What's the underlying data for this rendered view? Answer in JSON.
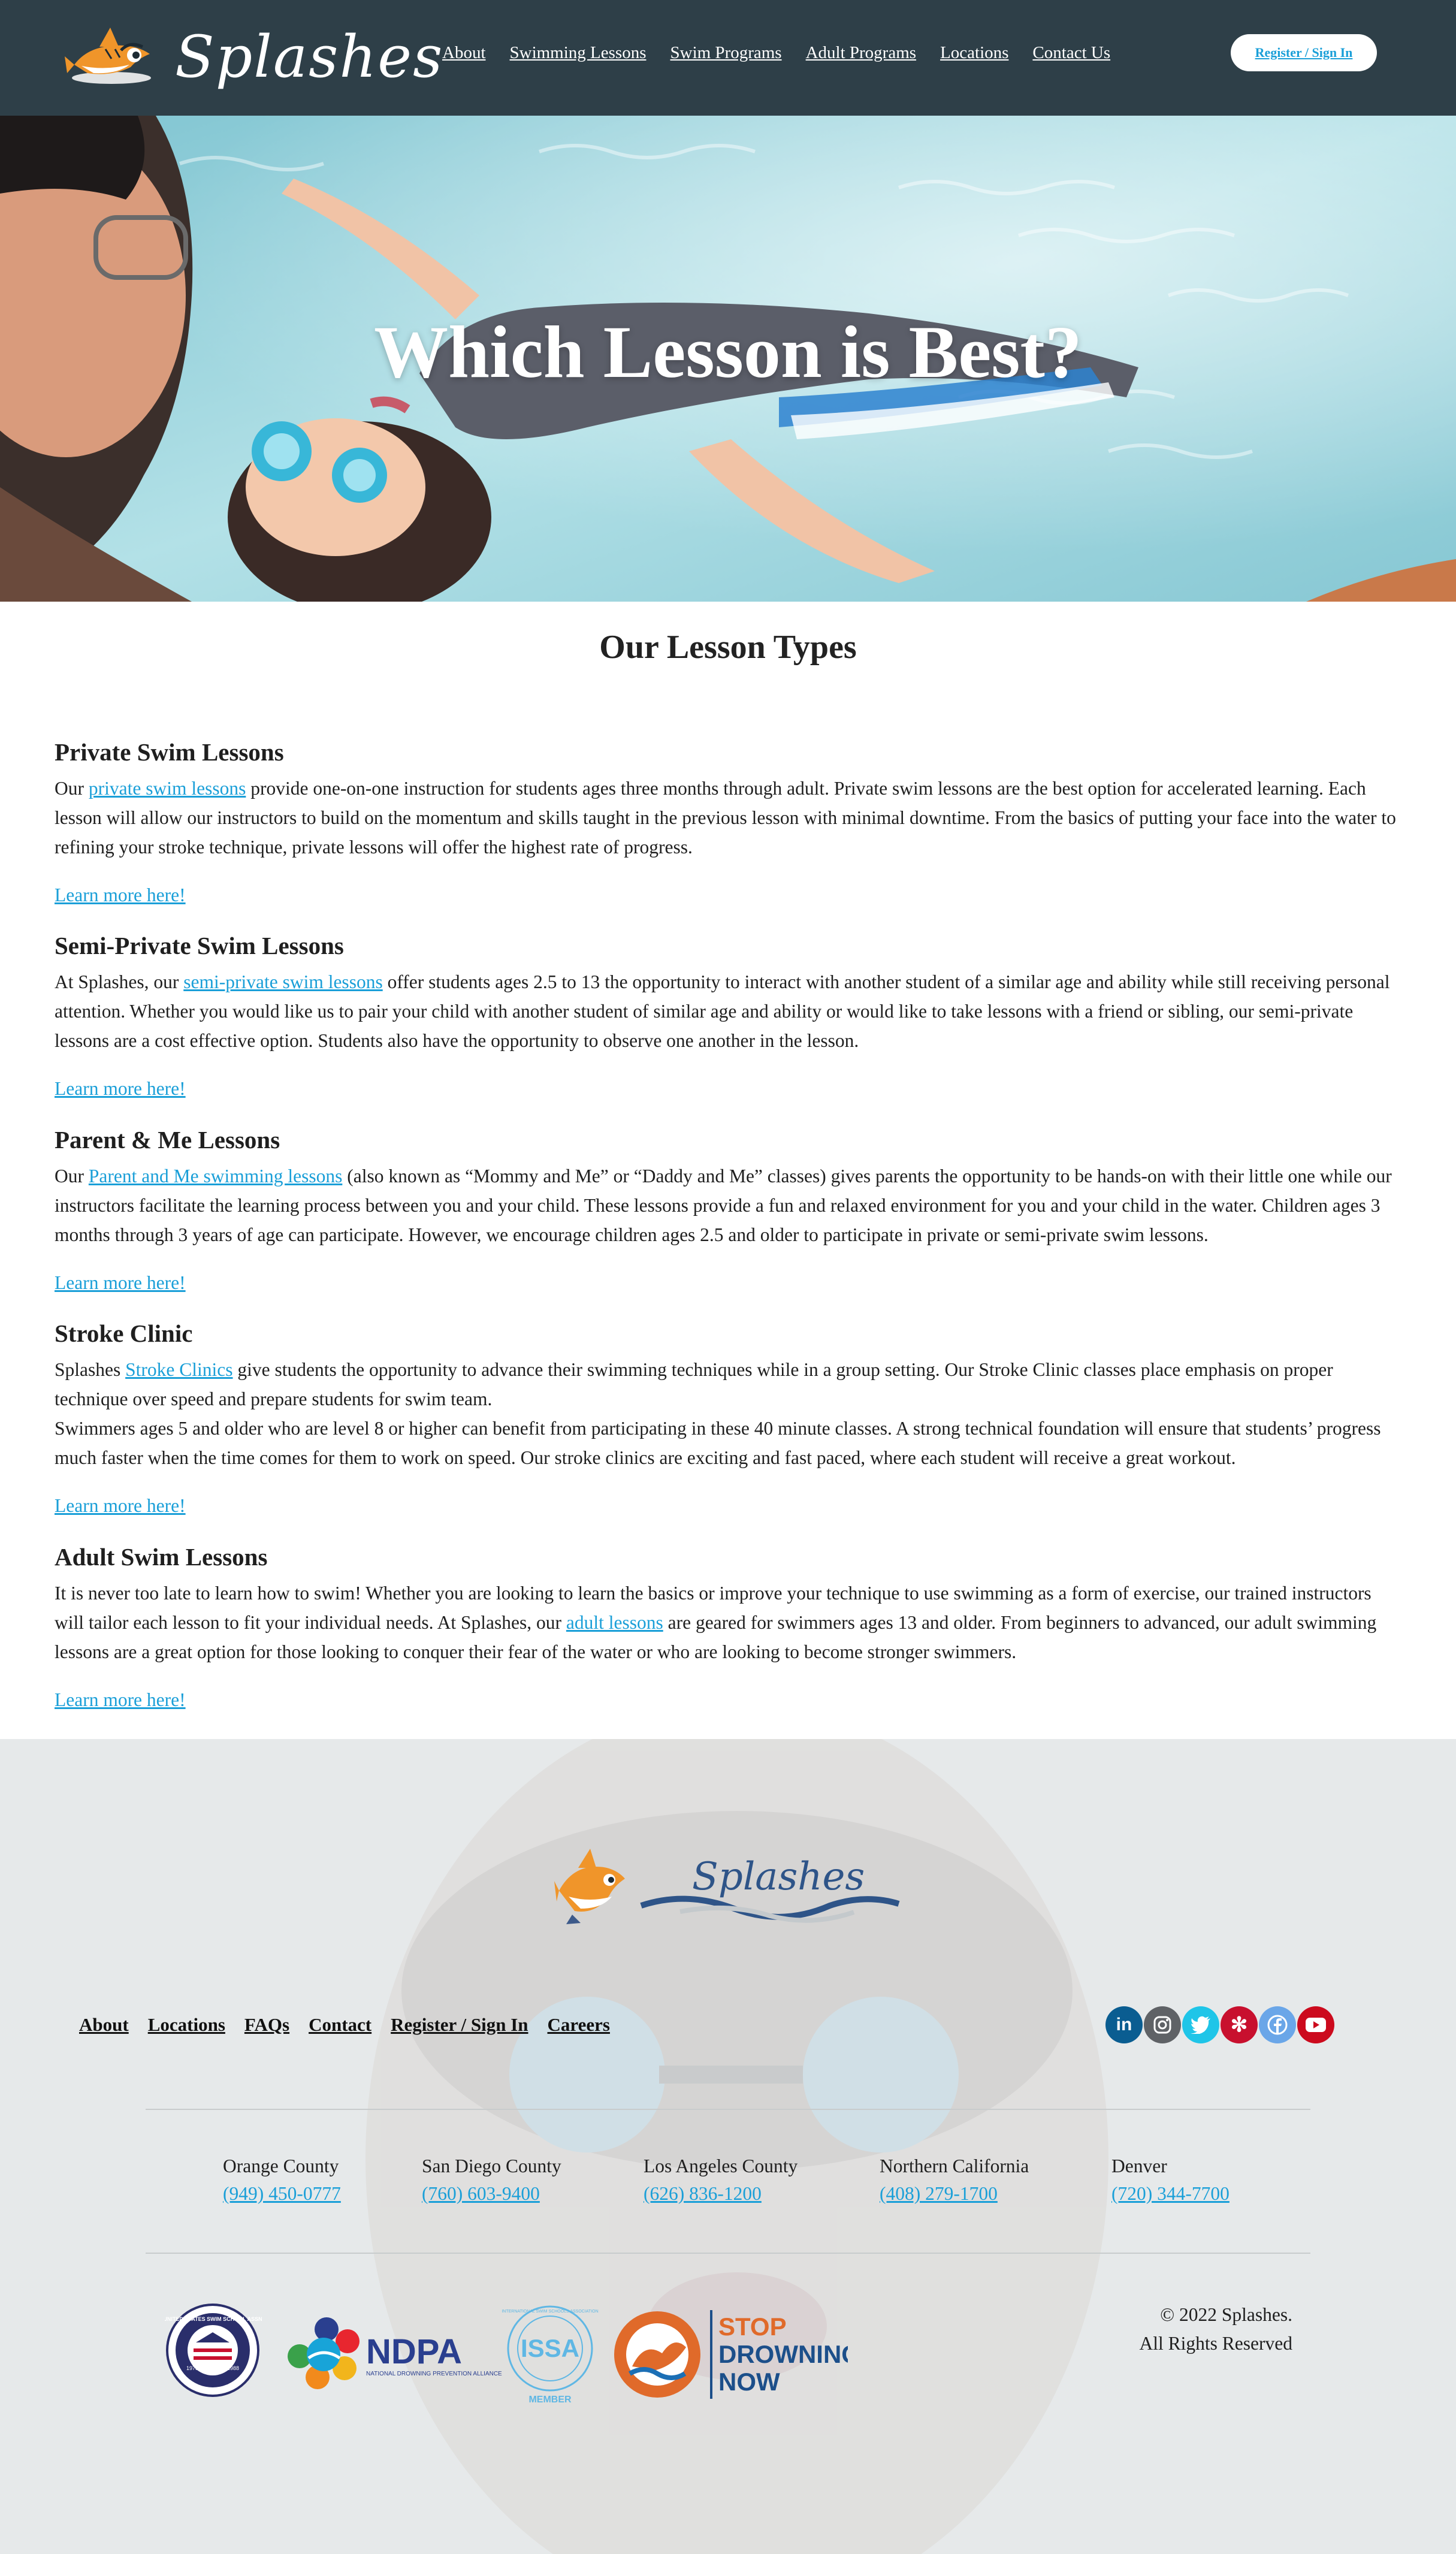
{
  "header": {
    "logo_text": "Splashes",
    "nav": [
      "About",
      "Swimming Lessons",
      "Swim Programs",
      "Adult Programs",
      "Locations",
      "Contact Us"
    ],
    "register_label": "Register / Sign In"
  },
  "hero": {
    "title": "Which Lesson is Best?"
  },
  "main": {
    "title": "Our Lesson Types",
    "learn_more": "Learn more here!",
    "sections": [
      {
        "heading": "Private Swim Lessons",
        "p1_before": "Our ",
        "p1_link": "private swim lessons",
        "p1_after": " provide one-on-one instruction for students ages three months through adult. Private swim lessons are the best option for accelerated learning. Each lesson will allow our instructors to build on the momentum and skills taught in the previous lesson with minimal downtime. From the basics of putting your face into the water to refining your stroke technique, private lessons will offer the highest rate of progress."
      },
      {
        "heading": "Semi-Private Swim Lessons",
        "p1_before": "At Splashes, our ",
        "p1_link": "semi-private swim lessons",
        "p1_after": " offer students ages 2.5 to 13 the opportunity to interact with another student of a similar age and ability while still receiving personal attention. Whether you would like us to pair your child with another student of similar age and ability or would like to take lessons with a friend or sibling, our semi-private lessons are a cost effective option. Students also have the opportunity to observe one another in the lesson."
      },
      {
        "heading": "Parent & Me Lessons",
        "p1_before": "Our ",
        "p1_link": "Parent and Me swimming lessons",
        "p1_after": " (also known as “Mommy and Me” or “Daddy and Me” classes) gives parents the opportunity to be hands-on with their little one while our instructors facilitate the learning process between you and your child. These lessons provide a fun and relaxed environment for you and your child in the water. Children ages 3 months through 3 years of age can participate. However, we encourage children ages 2.5 and older to participate in private or semi-private swim lessons."
      },
      {
        "heading": "Stroke Clinic",
        "p1_before": "Splashes ",
        "p1_link": "Stroke Clinics",
        "p1_after": " give students the opportunity to advance their swimming techniques while in a group setting. Our Stroke Clinic classes place emphasis on proper technique over speed and prepare students for swim team.",
        "p2": "Swimmers ages 5 and older who are level 8 or higher can benefit from participating in these 40 minute classes. A strong technical foundation will ensure that students’ progress much faster when the time comes for them to work on speed. Our stroke clinics are exciting and fast paced, where each student will receive a great workout."
      },
      {
        "heading": "Adult Swim Lessons",
        "p1_before": "It is never too late to learn how to swim! Whether you are looking to learn the basics or improve your technique to use swimming as a form of exercise, our trained instructors will tailor each lesson to fit your individual needs. At Splashes, our ",
        "p1_link": "adult lessons",
        "p1_after": " are geared for swimmers ages 13 and older. From beginners to advanced, our adult swimming lessons are a great option for those looking to conquer their fear of the water or who are looking to become stronger swimmers."
      }
    ]
  },
  "footer": {
    "logo_text": "Splashes",
    "nav": [
      "About",
      "Locations",
      "FAQs",
      "Contact",
      "Register / Sign In",
      "Careers"
    ],
    "social": [
      {
        "icon": "linkedin-icon",
        "glyph": "in",
        "color": "#0a5d91"
      },
      {
        "icon": "instagram-icon",
        "glyph": "◎",
        "color": "#5f6266"
      },
      {
        "icon": "twitter-icon",
        "glyph": "🐦",
        "color": "#1fc5e8"
      },
      {
        "icon": "yelp-icon",
        "glyph": "✻",
        "color": "#c8102e"
      },
      {
        "icon": "facebook-icon",
        "glyph": "f",
        "color": "#6aa6e8"
      },
      {
        "icon": "youtube-icon",
        "glyph": "▶",
        "color": "#cc0a1d"
      }
    ],
    "locations": [
      {
        "name": "Orange County",
        "phone": "(949) 450-0777"
      },
      {
        "name": "San Diego County",
        "phone": "(760) 603-9400"
      },
      {
        "name": "Los Angeles County",
        "phone": "(626) 836-1200"
      },
      {
        "name": "Northern California",
        "phone": "(408) 279-1700"
      },
      {
        "name": "Denver",
        "phone": "(720) 344-7700"
      }
    ],
    "badges": {
      "ndpa_text": "NDPA",
      "ndpa_sub": "NATIONAL DROWNING PREVENTION ALLIANCE",
      "issa_text": "ISSA",
      "issa_ring": "INTERNATIONAL SWIM SCHOOLS ASSOCIATION",
      "issa_member": "MEMBER",
      "usss_ring": "UNITED STATES SWIM SCHOOL ASSN",
      "usss_year_left": "1978",
      "usss_year_right": "1988",
      "stop_line1": "STOP",
      "stop_line2": "DROWNING",
      "stop_line3": "NOW"
    },
    "copyright_line1": "© 2022 Splashes.",
    "copyright_line2": "All Rights Reserved"
  },
  "colors": {
    "header_bg": "#2e3f48",
    "link": "#1a9fd8",
    "footer_bg": "#e6e9ea"
  }
}
